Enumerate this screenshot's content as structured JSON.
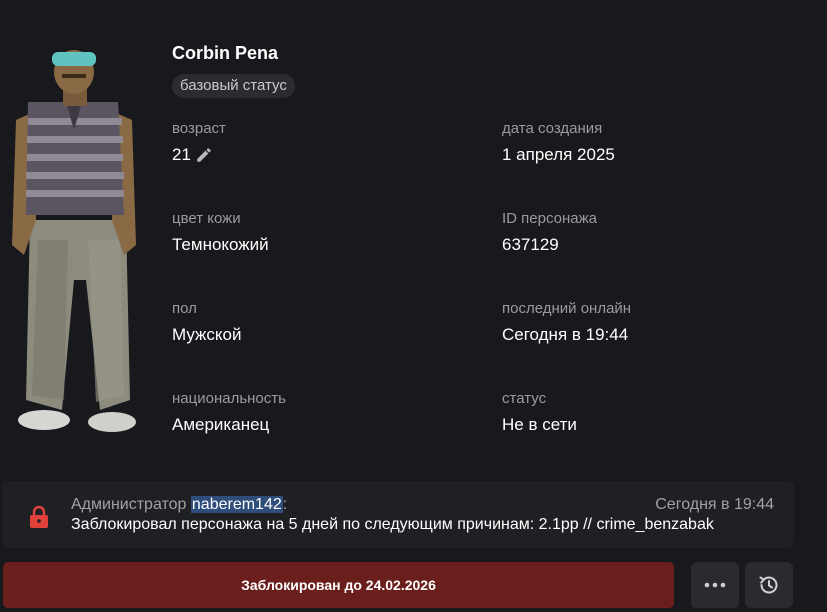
{
  "character": {
    "name": "Corbin Pena",
    "status_badge": "базовый статус"
  },
  "fields": {
    "age": {
      "label": "возраст",
      "value": "21"
    },
    "created": {
      "label": "дата создания",
      "value": "1 апреля 2025"
    },
    "skin": {
      "label": "цвет кожи",
      "value": "Темнокожий"
    },
    "id": {
      "label": "ID персонажа",
      "value": "637129"
    },
    "gender": {
      "label": "пол",
      "value": "Мужской"
    },
    "last_online": {
      "label": "последний онлайн",
      "value": "Сегодня в 19:44"
    },
    "nationality": {
      "label": "национальность",
      "value": "Американец"
    },
    "status": {
      "label": "статус",
      "value": "Не в сети"
    }
  },
  "log": {
    "prefix": "Администратор",
    "admin": "naberem142",
    "suffix": ":",
    "time": "Сегодня в 19:44",
    "text": "Заблокировал персонажа на 5 дней по следующим причинам: 2.1pp // crime_benzabak"
  },
  "actions": {
    "ban_label": "Заблокирован до 24.02.2026",
    "more_icon": "more-dots-icon",
    "history_icon": "history-clock-icon"
  },
  "colors": {
    "background": "#18191d",
    "ban_button": "#6a1f1c",
    "lock": "#e0413a",
    "highlight": "#2f4d7a"
  }
}
